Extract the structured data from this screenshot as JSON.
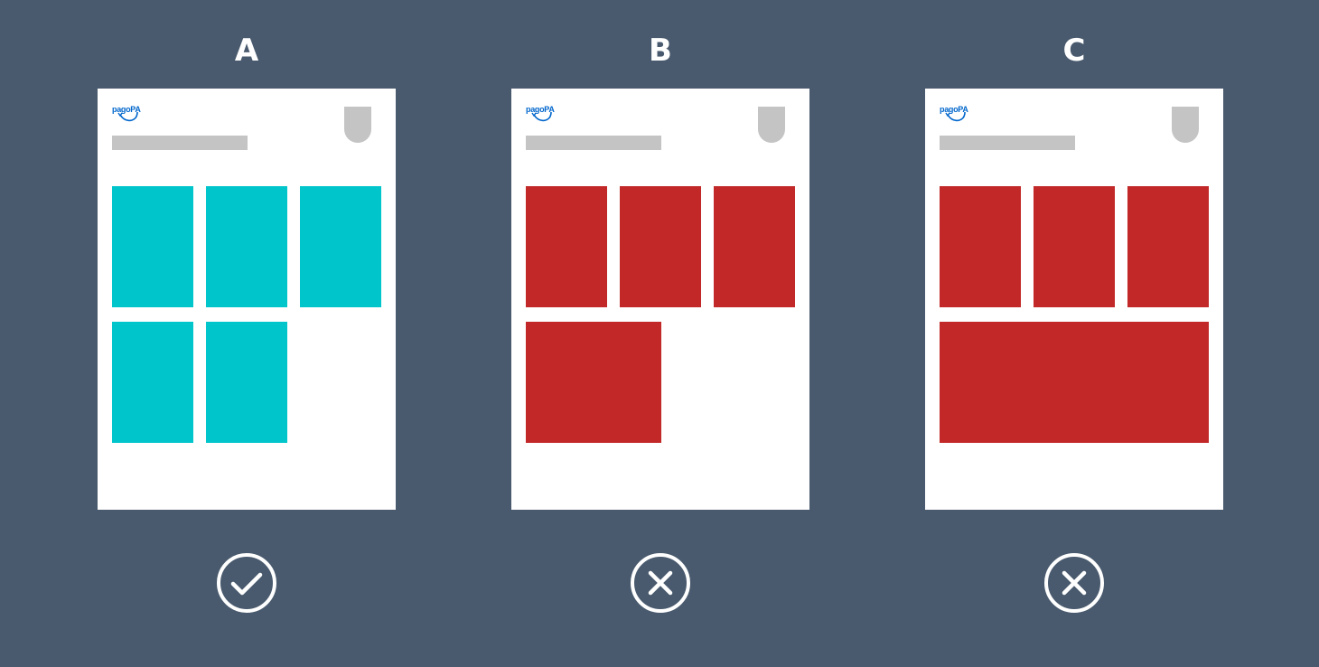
{
  "colors": {
    "background": "#495a6e",
    "card": "#ffffff",
    "placeholder": "#c4c4c4",
    "correct": "#00c5cb",
    "wrong": "#c22828",
    "logo": "#0066cc"
  },
  "logo": {
    "text": "pagoPA"
  },
  "columns": [
    {
      "label": "A",
      "status_icon": "check-circle-icon",
      "tile_color": "correct"
    },
    {
      "label": "B",
      "status_icon": "cross-circle-icon",
      "tile_color": "wrong"
    },
    {
      "label": "C",
      "status_icon": "cross-circle-icon",
      "tile_color": "wrong"
    }
  ]
}
